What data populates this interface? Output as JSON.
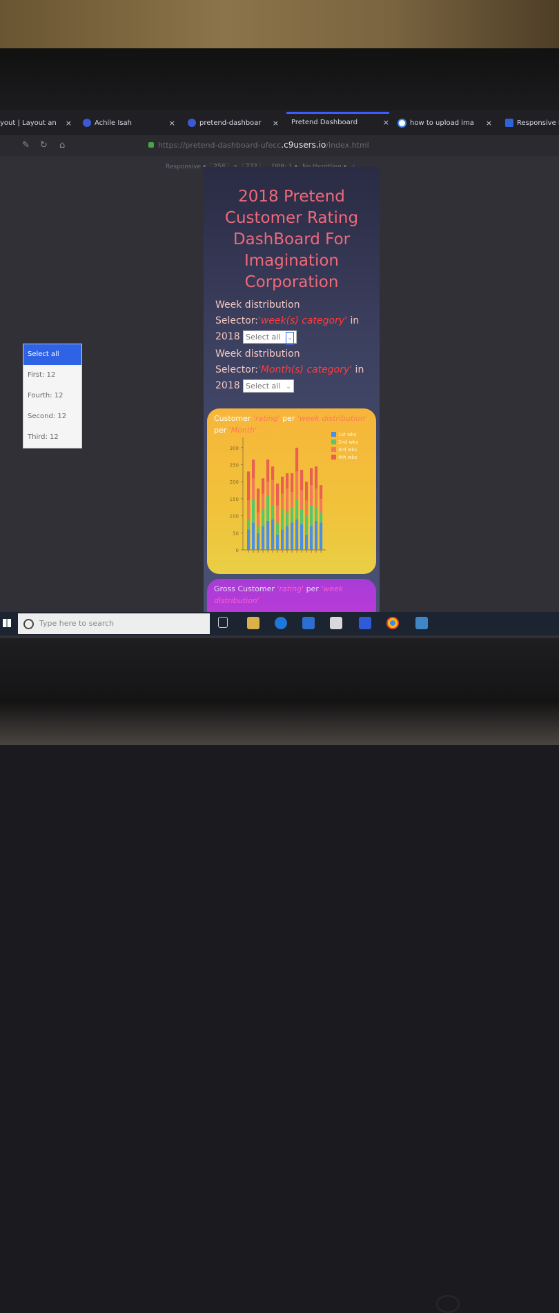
{
  "browser": {
    "tabs": [
      {
        "label": "yout | Layout an",
        "close": "×"
      },
      {
        "label": "Achile Isah",
        "close": "×"
      },
      {
        "label": "pretend-dashboar",
        "close": "×"
      },
      {
        "label": "Pretend Dashboard",
        "close": "×"
      },
      {
        "label": "how to upload ima",
        "close": "×"
      },
      {
        "label": "Responsive I",
        "close": ""
      }
    ],
    "url_prefix": "https://pretend-dashboard-ufecc",
    "url_host": ".c9users.io",
    "url_suffix": "/index.html",
    "responsive": {
      "mode": "Responsive ▾",
      "width": "258",
      "times": "×",
      "height": "732",
      "dpr": "DPR: 1 ▾",
      "throttle": "No throttling ▾"
    }
  },
  "page": {
    "title": "2018 Pretend Customer Rating DashBoard For Imagination Corporation",
    "selector1": {
      "line1": "Week distribution",
      "prefix": "Selector:",
      "emph": "'week(s) category'",
      "suffix": " in",
      "year": "2018",
      "select_value": "Select all"
    },
    "selector2": {
      "line1": "Week distribution",
      "prefix": "Selector:",
      "emph": "'Month(s) category'",
      "suffix": " in",
      "year": "2018",
      "select_value": "Select all"
    },
    "chart_card": {
      "label_a": "Customer",
      "label_b": "'rating'",
      "label_c": " per ",
      "label_d": "'week distribution'",
      "label_e": "per",
      "label_f": "'Month'"
    },
    "gross_card": {
      "label_a": "Gross Customer",
      "label_b": "'rating'",
      "label_c": " per ",
      "label_d": "'week",
      "label_e": "distribution'"
    }
  },
  "dropdown": {
    "items": [
      "Select all",
      "First: 12",
      "Fourth: 12",
      "Second: 12",
      "Third: 12"
    ]
  },
  "taskbar": {
    "search_placeholder": "Type here to search"
  },
  "colors": {
    "series": [
      "#4a90e2",
      "#5cc46b",
      "#f07a5a",
      "#e95f52"
    ],
    "title": "#f0697a",
    "chart_card": "#f4bc3a",
    "gross_card": "#b53cd8"
  },
  "chart_data": {
    "type": "bar",
    "stacked": true,
    "ylim": [
      0,
      330
    ],
    "yticks": [
      "0",
      "50",
      "100",
      "150",
      "200",
      "250",
      "300"
    ],
    "legend_position": "top-right",
    "series": [
      {
        "name": "1st wks",
        "values": [
          60,
          80,
          50,
          70,
          85,
          90,
          45,
          60,
          70,
          80,
          90,
          75,
          45,
          70,
          85,
          80
        ]
      },
      {
        "name": "2nd wks",
        "values": [
          30,
          70,
          20,
          50,
          75,
          40,
          35,
          60,
          40,
          45,
          60,
          45,
          55,
          60,
          40,
          30
        ]
      },
      {
        "name": "3rd wks",
        "values": [
          55,
          60,
          40,
          45,
          40,
          75,
          50,
          45,
          70,
          45,
          80,
          55,
          45,
          60,
          55,
          40
        ]
      },
      {
        "name": "4th wks",
        "values": [
          85,
          55,
          70,
          45,
          65,
          40,
          65,
          50,
          45,
          55,
          70,
          60,
          55,
          50,
          65,
          40
        ]
      }
    ]
  }
}
